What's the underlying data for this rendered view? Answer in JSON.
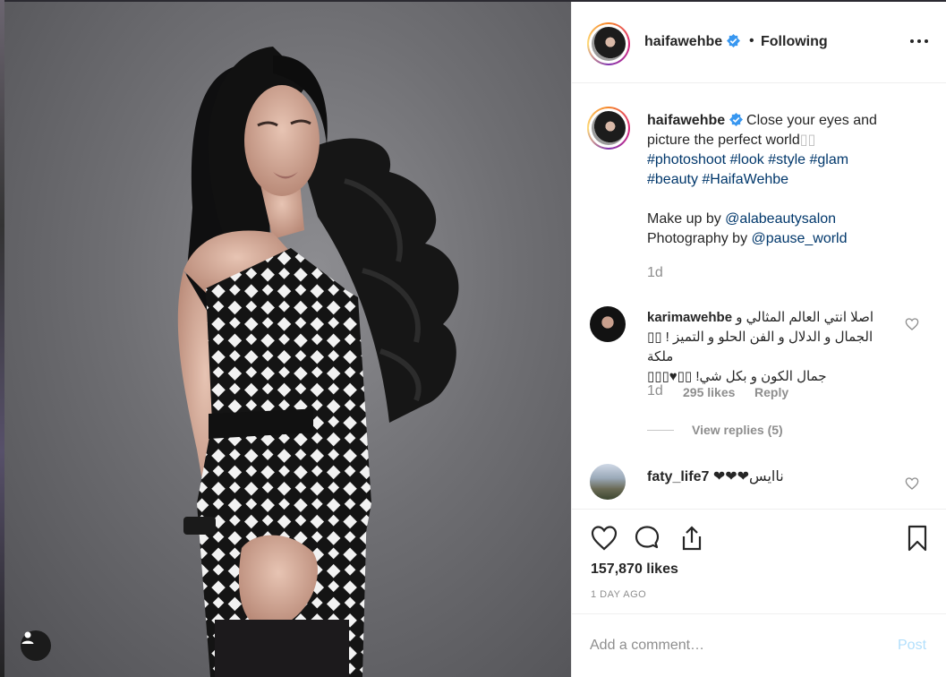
{
  "post": {
    "username": "haifawehbe",
    "separator": "•",
    "follow_state": "Following",
    "caption": {
      "username": "haifawehbe",
      "line1": "Close your eyes and picture the perfect world",
      "emoji_placeholder": "▯▯",
      "hashtags_line1": [
        "#photoshoot",
        "#look",
        "#style",
        "#glam"
      ],
      "hashtags_line2": [
        "#beauty",
        "#HaifaWehbe"
      ],
      "makeup_prefix": "Make up by",
      "makeup_handle": "@alabeautysalon",
      "photo_prefix": "Photography by",
      "photo_handle": "@pause_world",
      "time": "1d"
    },
    "comments": [
      {
        "username": "karimawehbe",
        "text_line1": "اصلا انتي العالم المثالي و",
        "text_line2": "الجمال و الدلال و الفن الحلو و التميز ! ▯▯ ملكة",
        "text_line3": "جمال الكون و بكل شي! ▯▯♥▯▯▯",
        "time": "1d",
        "likes": "295 likes",
        "reply": "Reply",
        "view_replies": "View replies (5)"
      },
      {
        "username": "faty_life7",
        "text": "ناايس❤❤❤"
      }
    ],
    "likes": "157,870 likes",
    "date": "1 DAY AGO",
    "add_comment_placeholder": "Add a comment…",
    "post_button": "Post"
  },
  "icons": {
    "verified": "verified-badge-icon",
    "more": "more-options-icon",
    "like": "heart-icon",
    "comment": "comment-bubble-icon",
    "share": "share-icon",
    "save": "bookmark-icon",
    "user_tag": "user-tag-icon"
  },
  "colors": {
    "link": "#00376b",
    "verified": "#3897f0",
    "muted": "#8e8e8e",
    "post_button_disabled": "#b2dffc"
  }
}
